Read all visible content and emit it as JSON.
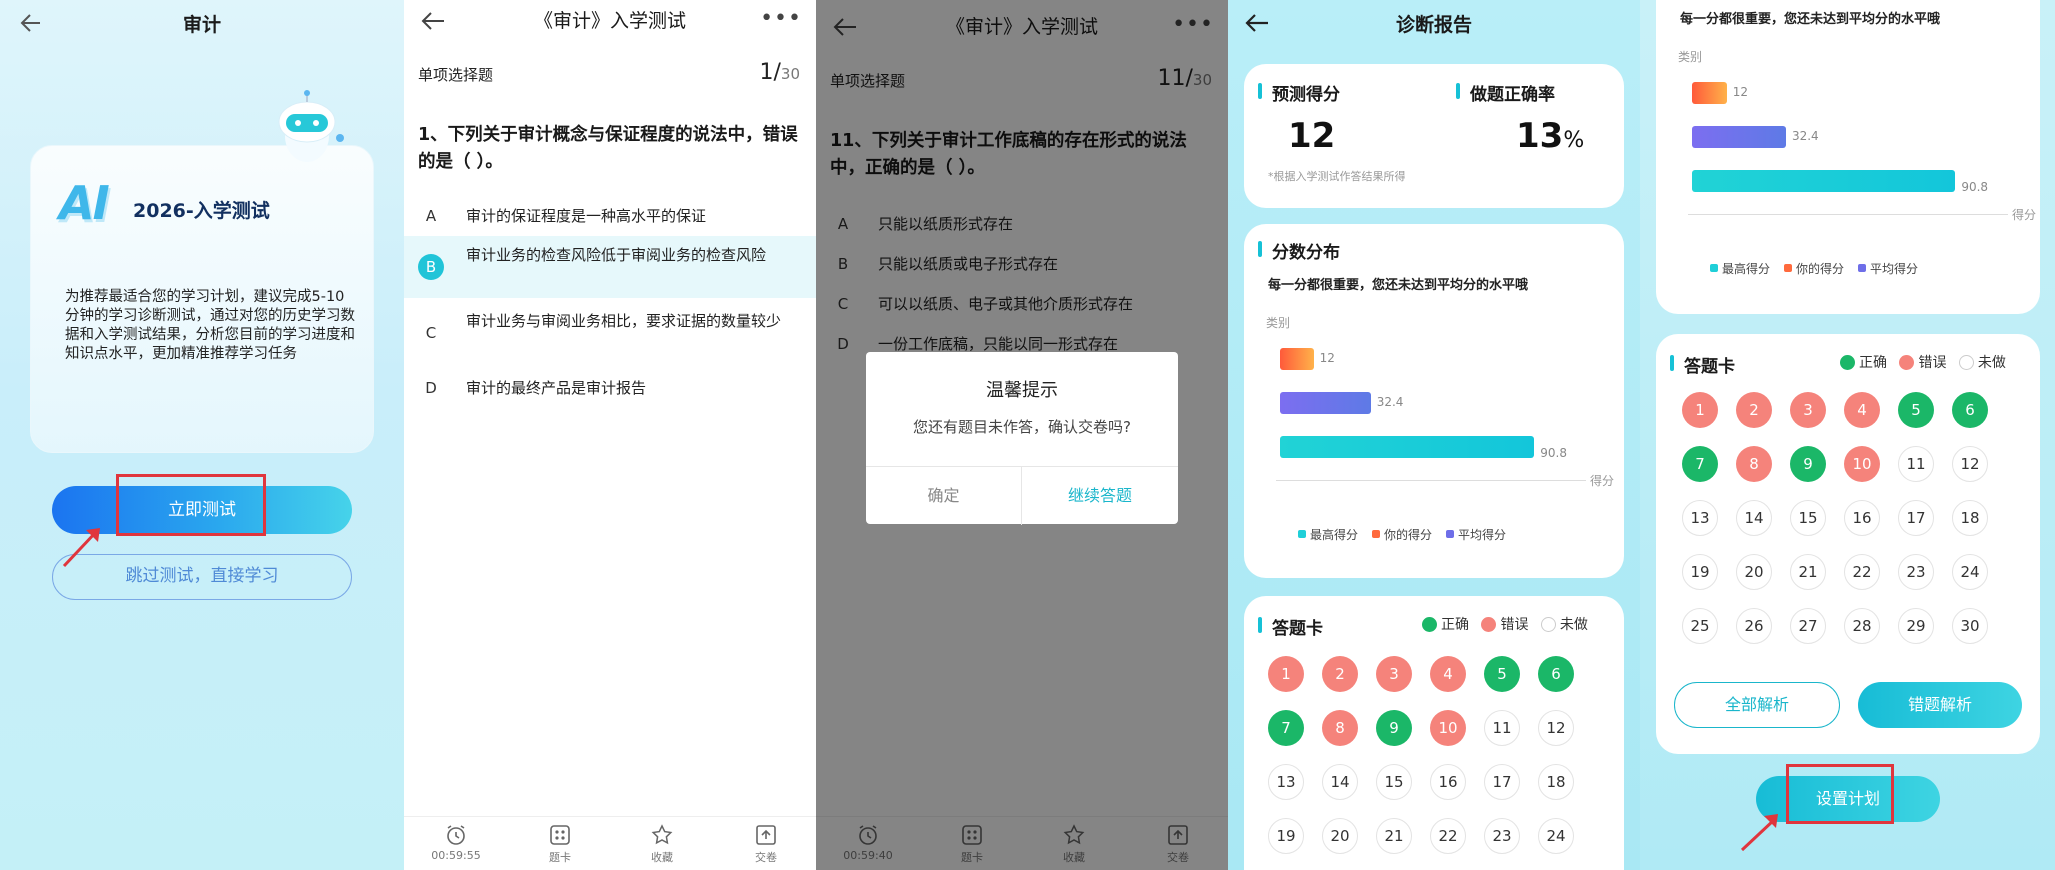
{
  "colors": {
    "accent": "#1ab6cb",
    "correct": "#1bb768",
    "wrong": "#f5837b",
    "highlight": "#e0353d",
    "max_bar": "#1fcfd8",
    "your_bar": "#ff6a3d",
    "avg_bar": "#6e6ee8"
  },
  "intro": {
    "title": "审计",
    "card_title": "2026-入学测试",
    "logo_text": "AI",
    "description": "为推荐最适合您的学习计划，建议完成5-10分钟的学习诊断测试，通过对您的历史学习数据和入学测试结果，分析您目前的学习进度和知识点水平，更加精准推荐学习任务",
    "start_button": "立即测试",
    "skip_button": "跳过测试，直接学习"
  },
  "quiz1": {
    "title": "《审计》入学测试",
    "type": "单项选择题",
    "current": "1/",
    "total": "30",
    "stem": "1、下列关于审计概念与保证程度的说法中，错误的是（   ）。",
    "options": [
      {
        "letter": "A",
        "text": "审计的保证程度是一种高水平的保证"
      },
      {
        "letter": "B",
        "text": "审计业务的检查风险低于审阅业务的检查风险"
      },
      {
        "letter": "C",
        "text": "审计业务与审阅业务相比，要求证据的数量较少"
      },
      {
        "letter": "D",
        "text": "审计的最终产品是审计报告"
      }
    ],
    "footer": {
      "timer": "00:59:55",
      "card": "题卡",
      "fav": "收藏",
      "submit": "交卷"
    }
  },
  "quiz2": {
    "title": "《审计》入学测试",
    "type": "单项选择题",
    "current": "11/",
    "total": "30",
    "stem": "11、下列关于审计工作底稿的存在形式的说法中，正确的是（   ）。",
    "options": [
      {
        "letter": "A",
        "text": "只能以纸质形式存在"
      },
      {
        "letter": "B",
        "text": "只能以纸质或电子形式存在"
      },
      {
        "letter": "C",
        "text": "可以以纸质、电子或其他介质形式存在"
      },
      {
        "letter": "D",
        "text": "一份工作底稿，只能以同一形式存在"
      }
    ],
    "dialog": {
      "title": "温馨提示",
      "message": "您还有题目未作答，确认交卷吗?",
      "cancel": "确定",
      "confirm": "继续答题"
    },
    "footer": {
      "timer": "00:59:40",
      "card": "题卡",
      "fav": "收藏",
      "submit": "交卷"
    }
  },
  "report": {
    "title": "诊断报告",
    "pred_label": "预测得分",
    "pred_value": "12",
    "acc_label": "做题正确率",
    "acc_value": "13",
    "acc_unit": "%",
    "note": "*根据入学测试作答结果所得",
    "dist_title": "分数分布",
    "dist_sub": "每一分都很重要，您还未达到平均分的水平哦",
    "answer_card_title": "答题卡",
    "legend_right": "正确",
    "legend_wrong": "错误",
    "legend_none": "未做",
    "btn_all": "全部解析",
    "btn_wrong": "错题解析",
    "btn_plan": "设置计划"
  },
  "chart_data": {
    "type": "bar",
    "orientation": "horizontal",
    "ylabel": "类别",
    "xlabel": "得分",
    "series": [
      {
        "name": "你的得分",
        "value": 12,
        "color": "#ff6a3d"
      },
      {
        "name": "平均得分",
        "value": 32.4,
        "color": "#6e6ee8"
      },
      {
        "name": "最高得分",
        "value": 90.8,
        "color": "#1fcfd8"
      }
    ],
    "legend": [
      "最高得分",
      "你的得分",
      "平均得分"
    ],
    "xlim": [
      0,
      100
    ]
  },
  "answers": [
    "wrong",
    "wrong",
    "wrong",
    "wrong",
    "right",
    "right",
    "right",
    "wrong",
    "right",
    "wrong",
    "none",
    "none",
    "none",
    "none",
    "none",
    "none",
    "none",
    "none",
    "none",
    "none",
    "none",
    "none",
    "none",
    "none",
    "none",
    "none",
    "none",
    "none",
    "none",
    "none"
  ]
}
